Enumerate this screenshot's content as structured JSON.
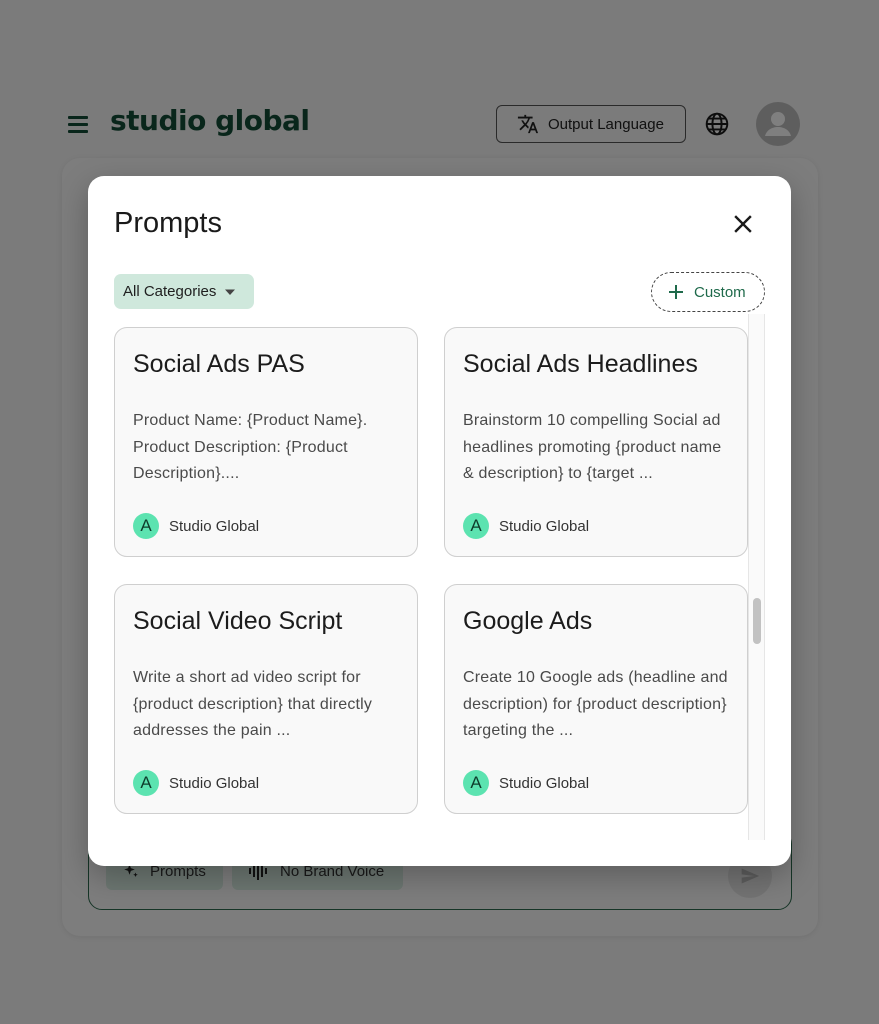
{
  "app": {
    "logo": "studio global",
    "output_language_label": "Output Language",
    "composer": {
      "prompts_chip": "Prompts",
      "brand_voice_chip": "No Brand Voice"
    }
  },
  "modal": {
    "title": "Prompts",
    "category_filter": "All Categories",
    "custom_button": "Custom",
    "cards": [
      {
        "title": "Social Ads PAS",
        "description": "Product Name: {Product Name}. Product Description: {Product Description}....",
        "author_initial": "A",
        "author": "Studio Global"
      },
      {
        "title": "Social Ads Headlines",
        "description": "Brainstorm 10 compelling Social ad headlines promoting {product name & description} to {target ...",
        "author_initial": "A",
        "author": "Studio Global"
      },
      {
        "title": "Social Video Script",
        "description": "Write a short ad video script for {product description} that directly addresses the pain ...",
        "author_initial": "A",
        "author": "Studio Global"
      },
      {
        "title": "Google Ads",
        "description": "Create 10 Google ads (headline and description) for {product description} targeting the ...",
        "author_initial": "A",
        "author": "Studio Global"
      }
    ]
  },
  "colors": {
    "brand_green": "#134d36",
    "accent_mint": "#5ce3b0",
    "chip_bg": "#cfe8dc"
  },
  "icons": [
    "menu-icon",
    "translate-icon",
    "globe-icon",
    "user-icon",
    "close-icon",
    "dropdown-arrow-icon",
    "plus-icon",
    "sparkle-icon",
    "waveform-icon",
    "send-icon"
  ]
}
